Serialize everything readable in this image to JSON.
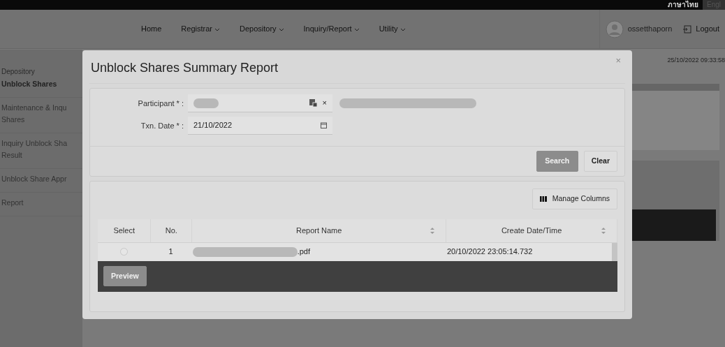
{
  "top_bar": {
    "languages": [
      {
        "label": "ภาษาไทย",
        "selected": true
      },
      {
        "label": "Engl",
        "selected": false
      }
    ]
  },
  "nav": {
    "items": [
      {
        "label": "Home",
        "dropdown": false
      },
      {
        "label": "Registrar",
        "dropdown": true
      },
      {
        "label": "Depository",
        "dropdown": true
      },
      {
        "label": "Inquiry/Report",
        "dropdown": true
      },
      {
        "label": "Utility",
        "dropdown": true
      }
    ],
    "user": "ossetthaporn",
    "logout": "Logout",
    "datetime": "25/10/2022 09:33:58"
  },
  "sidebar": {
    "section": "Depository",
    "items": [
      {
        "lines": [
          "Unblock Shares"
        ],
        "selected": true
      },
      {
        "lines": [
          "Maintenance & Inqu",
          "Shares"
        ],
        "selected": false
      },
      {
        "lines": [
          "Inquiry Unblock Sha",
          "Result"
        ],
        "selected": false
      },
      {
        "lines": [
          "Unblock Share Appr"
        ],
        "selected": false
      },
      {
        "lines": [
          "Report"
        ],
        "selected": false
      }
    ]
  },
  "modal": {
    "title": "Unblock Shares Summary Report",
    "close": "×",
    "fields": [
      {
        "kind": "lookup",
        "label": "Participant * :",
        "redacted": true,
        "clear": "×"
      },
      {
        "kind": "date",
        "label": "Txn. Date * :",
        "value": "21/10/2022"
      }
    ],
    "buttons": [
      {
        "label": "Search",
        "disabled": true
      },
      {
        "label": "Clear",
        "disabled": false
      }
    ],
    "manage_columns": "Manage Columns",
    "table": {
      "columns": [
        {
          "label": "Select",
          "sortable": false
        },
        {
          "label": "No.",
          "sortable": false
        },
        {
          "label": "Report Name",
          "sortable": true
        },
        {
          "label": "Create Date/Time",
          "sortable": true
        }
      ],
      "rows": [
        {
          "selected": false,
          "no": "1",
          "report_name": ".pdf",
          "name_redacted": true,
          "create_datetime": "20/10/2022 23:05:14.732"
        }
      ]
    },
    "preview": {
      "label": "Preview",
      "disabled": true
    }
  }
}
